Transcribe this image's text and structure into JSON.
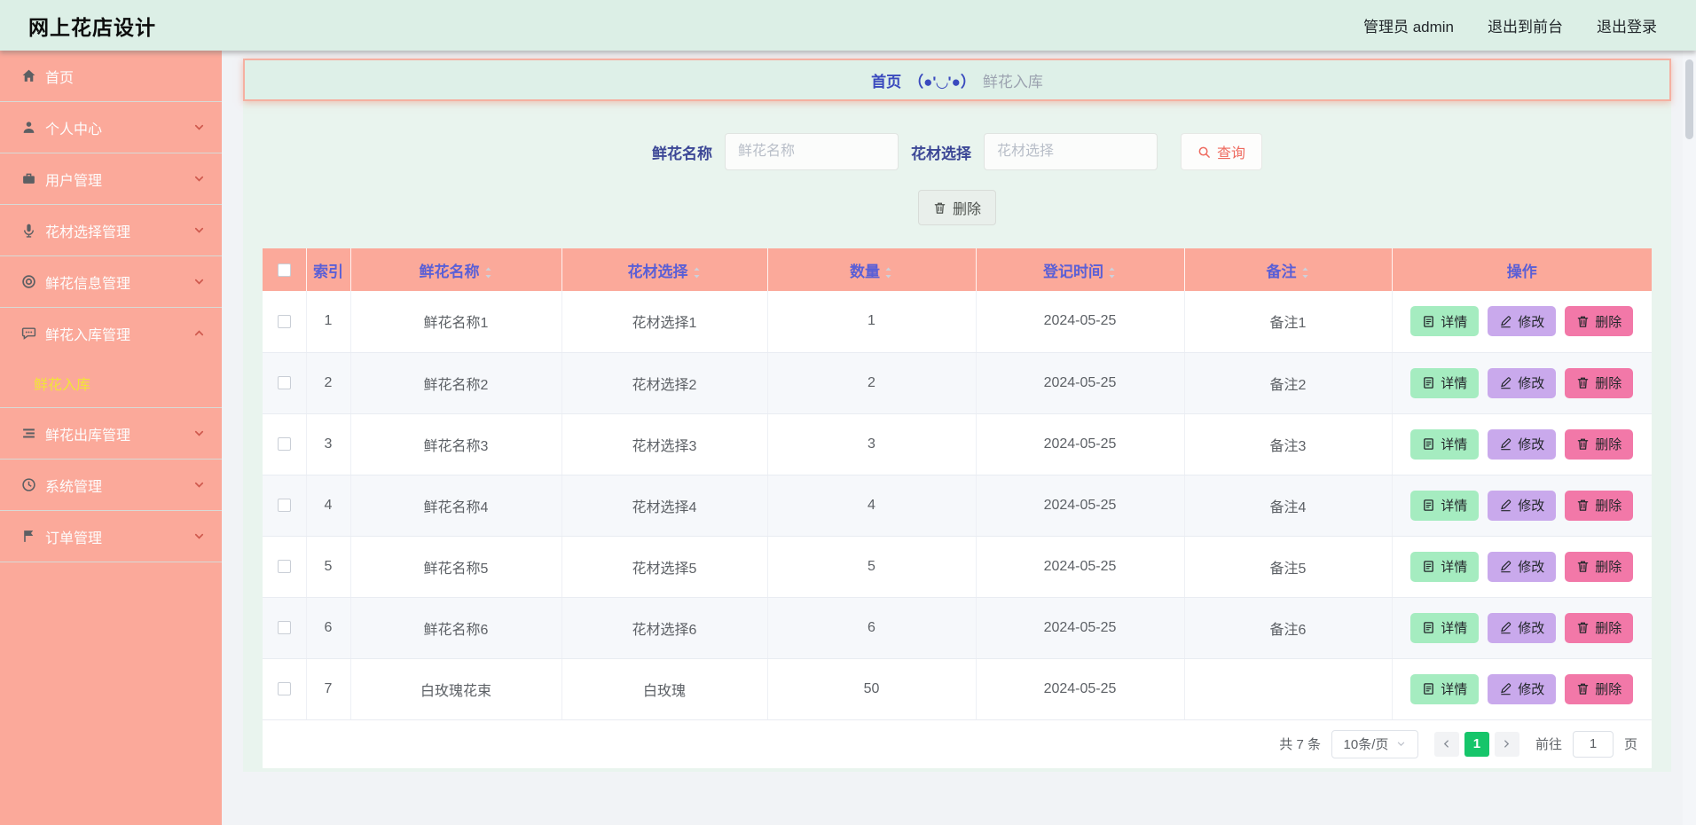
{
  "header": {
    "title": "网上花店设计",
    "links": [
      "管理员 admin",
      "退出到前台",
      "退出登录"
    ]
  },
  "sidebar": {
    "items": [
      {
        "label": "首页",
        "icon": "home-icon",
        "expandable": false
      },
      {
        "label": "个人中心",
        "icon": "user-icon",
        "expandable": true,
        "state": "collapsed"
      },
      {
        "label": "用户管理",
        "icon": "briefcase-icon",
        "expandable": true,
        "state": "collapsed"
      },
      {
        "label": "花材选择管理",
        "icon": "microphone-icon",
        "expandable": true,
        "state": "collapsed"
      },
      {
        "label": "鲜花信息管理",
        "icon": "target-icon",
        "expandable": true,
        "state": "collapsed"
      },
      {
        "label": "鲜花入库管理",
        "icon": "message-icon",
        "expandable": true,
        "state": "expanded",
        "children": [
          {
            "label": "鲜花入库",
            "active": true
          }
        ]
      },
      {
        "label": "鲜花出库管理",
        "icon": "list-icon",
        "expandable": true,
        "state": "collapsed"
      },
      {
        "label": "系统管理",
        "icon": "clock-icon",
        "expandable": true,
        "state": "collapsed"
      },
      {
        "label": "订单管理",
        "icon": "flag-icon",
        "expandable": true,
        "state": "collapsed"
      }
    ]
  },
  "breadcrumb": {
    "home": "首页",
    "separator": "（●'◡'●）",
    "current": "鲜花入库"
  },
  "search": {
    "name_label": "鲜花名称",
    "name_placeholder": "鲜花名称",
    "material_label": "花材选择",
    "material_placeholder": "花材选择",
    "query_label": "查询",
    "delete_label": "删除"
  },
  "table": {
    "columns": [
      {
        "key": "index",
        "label": "索引",
        "sortable": false
      },
      {
        "key": "name",
        "label": "鲜花名称",
        "sortable": true
      },
      {
        "key": "material",
        "label": "花材选择",
        "sortable": true
      },
      {
        "key": "qty",
        "label": "数量",
        "sortable": true
      },
      {
        "key": "date",
        "label": "登记时间",
        "sortable": true
      },
      {
        "key": "note",
        "label": "备注",
        "sortable": true
      },
      {
        "key": "actions",
        "label": "操作",
        "sortable": false
      }
    ],
    "actions": {
      "detail": "详情",
      "edit": "修改",
      "delete": "删除"
    },
    "rows": [
      {
        "index": "1",
        "name": "鲜花名称1",
        "material": "花材选择1",
        "qty": "1",
        "date": "2024-05-25",
        "note": "备注1"
      },
      {
        "index": "2",
        "name": "鲜花名称2",
        "material": "花材选择2",
        "qty": "2",
        "date": "2024-05-25",
        "note": "备注2"
      },
      {
        "index": "3",
        "name": "鲜花名称3",
        "material": "花材选择3",
        "qty": "3",
        "date": "2024-05-25",
        "note": "备注3"
      },
      {
        "index": "4",
        "name": "鲜花名称4",
        "material": "花材选择4",
        "qty": "4",
        "date": "2024-05-25",
        "note": "备注4"
      },
      {
        "index": "5",
        "name": "鲜花名称5",
        "material": "花材选择5",
        "qty": "5",
        "date": "2024-05-25",
        "note": "备注5"
      },
      {
        "index": "6",
        "name": "鲜花名称6",
        "material": "花材选择6",
        "qty": "6",
        "date": "2024-05-25",
        "note": "备注6"
      },
      {
        "index": "7",
        "name": "白玫瑰花束",
        "material": "白玫瑰",
        "qty": "50",
        "date": "2024-05-25",
        "note": ""
      }
    ]
  },
  "pagination": {
    "total": "共 7 条",
    "page_size": "10条/页",
    "current_page": "1",
    "goto_label": "前往",
    "goto_value": "1",
    "page_unit": "页"
  },
  "theme": {
    "header_bg": "#dcefe6",
    "sidebar_bg": "#fba99a",
    "panel_bg": "#e9f4ee",
    "breadcrumb_border": "#f5b0a1",
    "active_submenu_text": "#f2e438",
    "table_header_bg": "#fba99a",
    "table_header_text": "#5a5fd6",
    "detail_button_bg": "#a5ecc0",
    "edit_button_bg": "#c9a9ec",
    "delete_button_bg": "#f278a8",
    "query_button_text": "#ee6a5f",
    "pager_active_bg": "#16c56a"
  }
}
